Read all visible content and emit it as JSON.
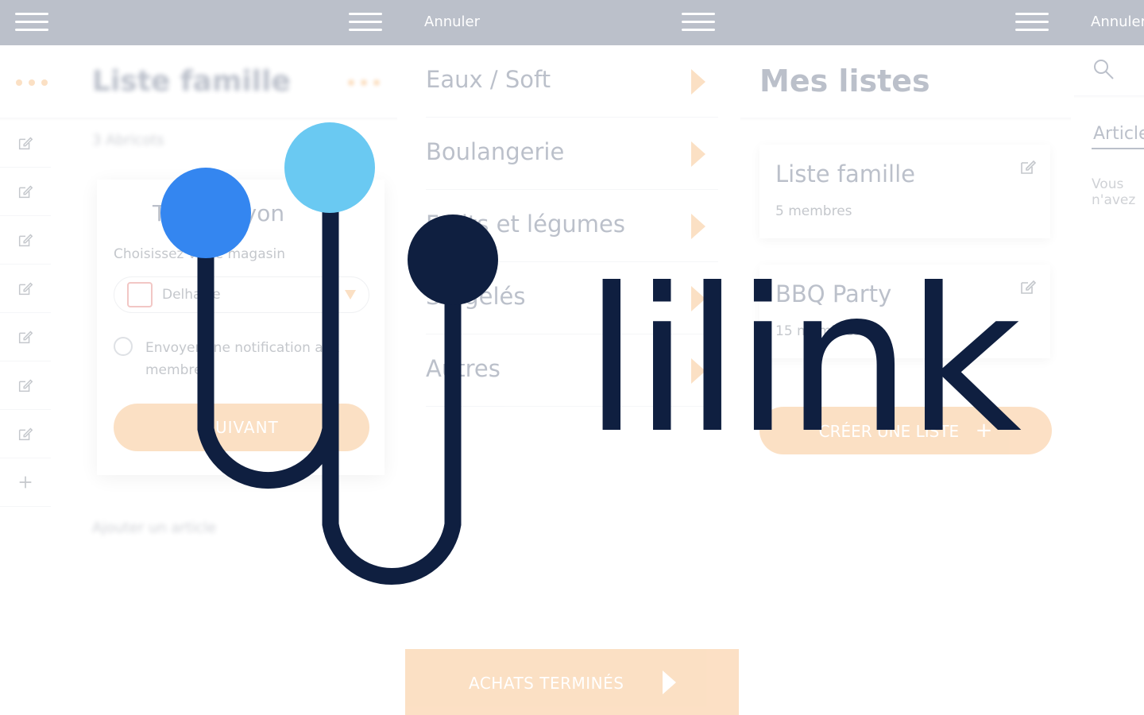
{
  "topbar": {
    "cancel_1": "Annuler",
    "cancel_2": "Annuler"
  },
  "panel_list": {
    "title": "Liste famille",
    "count": "3 Abricots",
    "add_item": "Ajouter un article",
    "modal": {
      "title_start": "T",
      "title_end": "rayon",
      "label": "Choisissez votre magasin",
      "store_value": "Delhaize",
      "notify_text": "Envoyer une notification aux membres",
      "next_button": "SUIVANT"
    }
  },
  "panel_categories": {
    "items": [
      "Eaux / Soft",
      "Boulangerie",
      "Fruits et légumes",
      "Surgelés",
      "Autres"
    ],
    "finish_button": "ACHATS TERMINÉS"
  },
  "panel_lists": {
    "title": "Mes listes",
    "cards": [
      {
        "title": "Liste famille",
        "subtitle": "5 membres"
      },
      {
        "title": "BBQ Party",
        "subtitle": "15 membres"
      }
    ],
    "create_button": "CRÉER UNE LISTE",
    "create_plus": "+"
  },
  "panel_articles": {
    "tab": "Articles",
    "empty_text": "Vous n'avez"
  },
  "brand": {
    "wordmark": "lilink",
    "color_dark": "#0f1f40",
    "color_blue": "#3486f0",
    "color_light_blue": "#6ac9f2",
    "accent": "#f5a04a"
  }
}
